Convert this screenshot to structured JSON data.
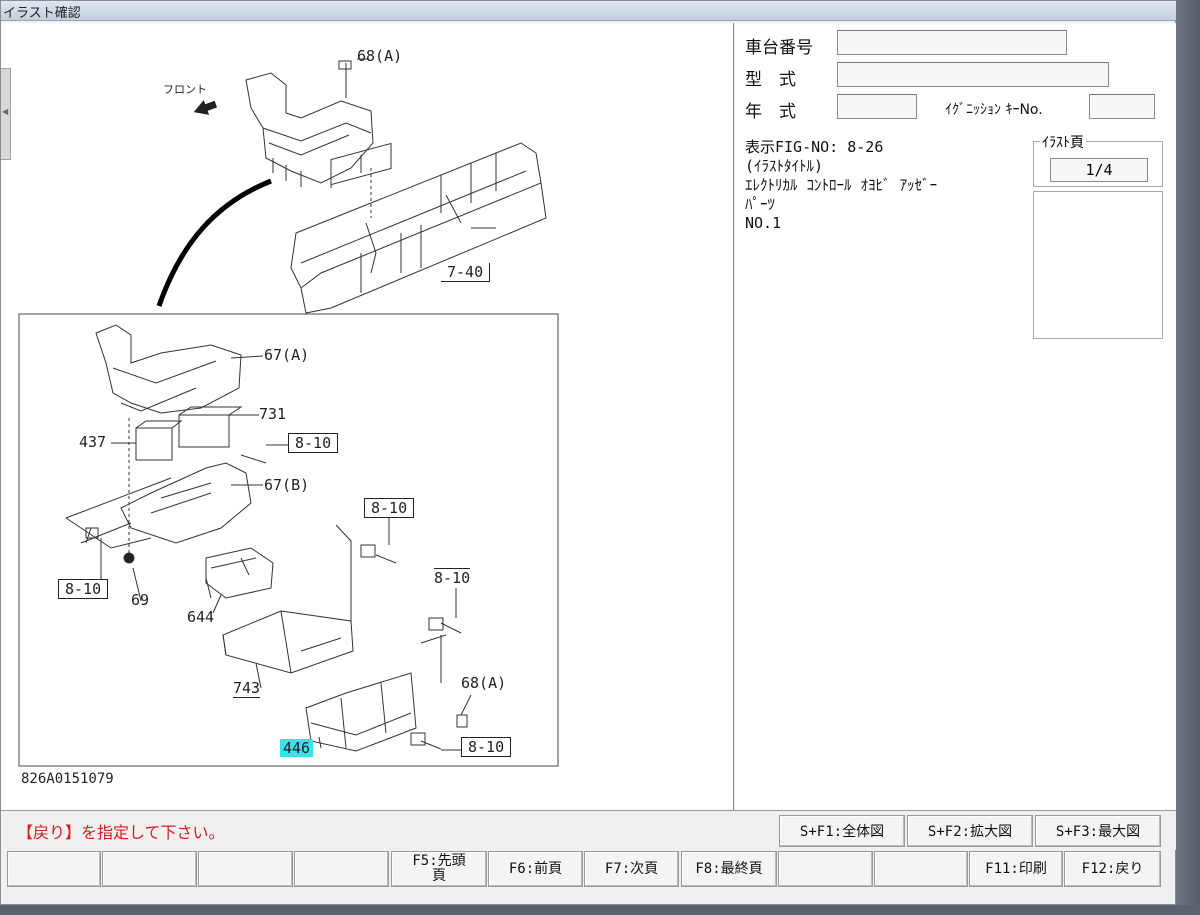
{
  "window": {
    "title": "イラスト確認"
  },
  "illustration": {
    "front_label": "フロント",
    "diagram_code": "826A0151079",
    "callouts": {
      "c68a_top": "68(A)",
      "c7_40": "7-40",
      "c67a": "67(A)",
      "c731": "731",
      "c437": "437",
      "c8_10_a": "8-10",
      "c67b": "67(B)",
      "c8_10_b": "8-10",
      "c8_10_c": "8-10",
      "c69": "69",
      "c8_10_d": "8-10",
      "c644": "644",
      "c743": "743",
      "c68a_bottom": "68(A)",
      "c8_10_e": "8-10",
      "c446": "446"
    }
  },
  "info": {
    "chassis_label": "車台番号",
    "chassis_value": "",
    "model_label": "型　式",
    "model_value": "",
    "year_label": "年　式",
    "year_value": "",
    "ignition_label": "ｲｸﾞﾆｯｼｮﾝ ｷｰNo.",
    "ignition_value": "",
    "fig_no": "表示FIG-NO: 8-26",
    "title_tag": "(ｲﾗｽﾄﾀｲﾄﾙ)",
    "title_line1": "ｴﾚｸﾄﾘｶﾙ ｺﾝﾄﾛｰﾙ ｵﾖﾋﾞ ｱｯｾﾞｰ",
    "title_line2": "ﾊﾟｰﾂ",
    "title_line3": "NO.1",
    "page_group_label": "ｲﾗｽﾄ頁",
    "page_value": "1/4"
  },
  "status": {
    "message": "【戻り】を指定して下さい。"
  },
  "zoom_buttons": {
    "full": "S+F1:全体図",
    "enlarge": "S+F2:拡大図",
    "max": "S+F3:最大図"
  },
  "function_keys": {
    "f5": "F5:先頭頁",
    "f6": "F6:前頁",
    "f7": "F7:次頁",
    "f8": "F8:最終頁",
    "f11": "F11:印刷",
    "f12": "F12:戻り"
  }
}
